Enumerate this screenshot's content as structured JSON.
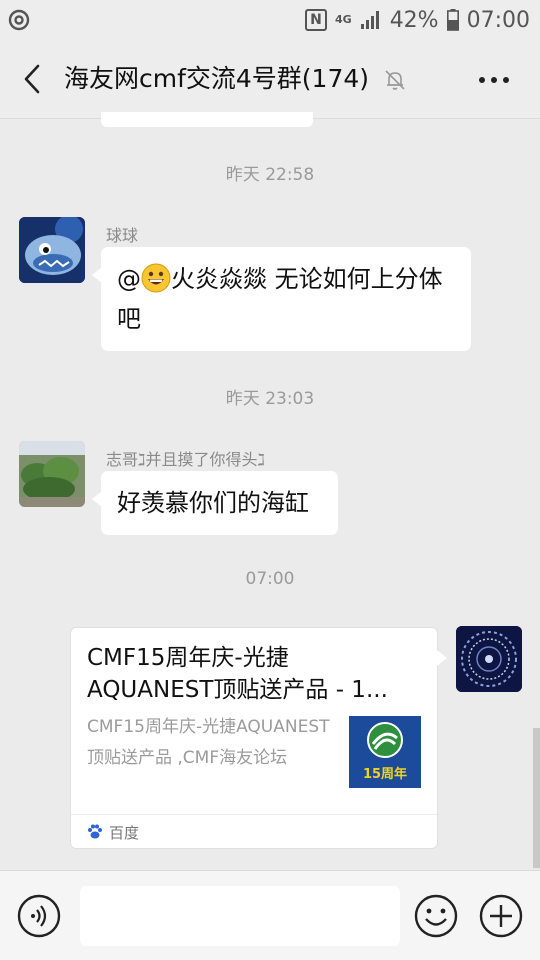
{
  "status_bar": {
    "battery": "42%",
    "time": "07:00",
    "network": "4G",
    "nfc": "N"
  },
  "header": {
    "title": "海友网cmf交流4号群(174)",
    "back_icon": "chevron-left-icon",
    "mute_icon": "bell-off-icon",
    "more_icon": "more-dots-icon"
  },
  "messages": [
    {
      "type": "time",
      "text": "昨天 22:58"
    },
    {
      "type": "text",
      "sender": "球球",
      "text_before": "@",
      "emoji": "grinning-face",
      "text_after": "火炎焱燚  无论如何上分体吧"
    },
    {
      "type": "time",
      "text": "昨天 23:03"
    },
    {
      "type": "text",
      "sender": "志哥ℷ并且摸了你得头ℷ",
      "text": "好羡慕你们的海缸"
    },
    {
      "type": "time",
      "text": "07:00"
    },
    {
      "type": "link_card",
      "from_self": true,
      "title_line1": "CMF15周年庆-光捷",
      "title_line2": "AQUANEST顶贴送产品 - 1...",
      "description": "CMF15周年庆-光捷AQUANEST顶贴送产品 ,CMF海友论坛",
      "thumb_text": "15周年",
      "source": "百度"
    }
  ],
  "input_bar": {
    "voice_icon": "voice-icon",
    "emoji_icon": "smiley-icon",
    "plus_icon": "plus-circle-icon"
  },
  "colors": {
    "background": "#ebebeb",
    "bubble": "#ffffff",
    "time_text": "#9a9a9a"
  }
}
